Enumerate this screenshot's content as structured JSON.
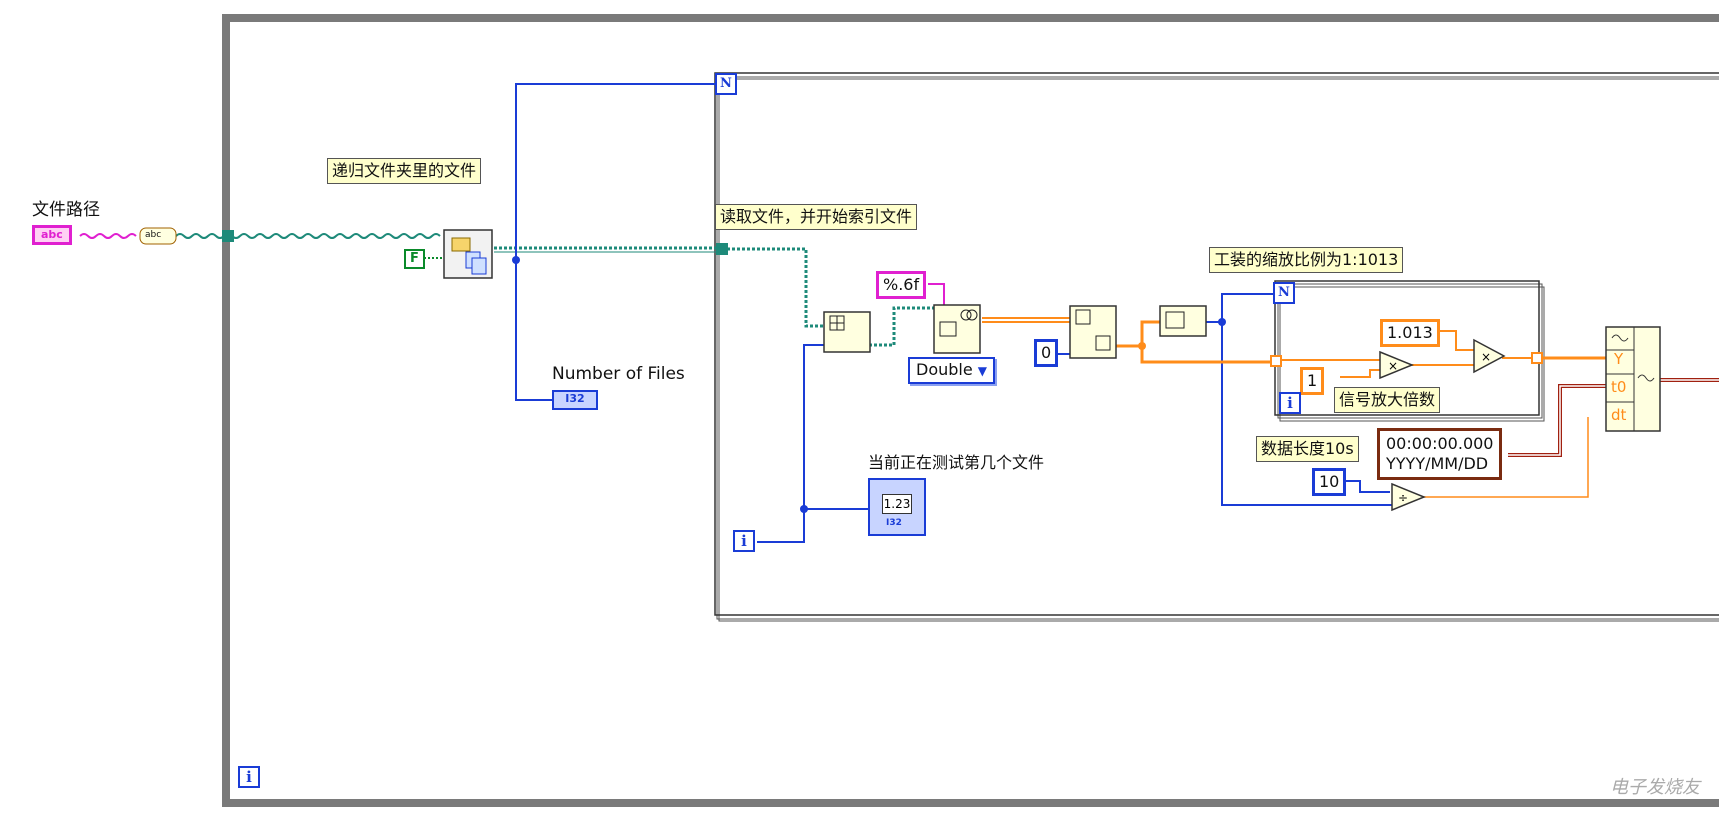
{
  "labels": {
    "file_path": "文件路径",
    "number_of_files": "Number of Files",
    "current_file": "当前正在测试第几个文件"
  },
  "comments": {
    "recursive": "递归文件夹里的文件",
    "read_file": "读取文件，并开始索引文件",
    "scale": "工装的缩放比例为1:1013",
    "gain": "信号放大倍数",
    "data_length": "数据长度10s"
  },
  "constants": {
    "false_const": "F",
    "format": "%.6f",
    "type": "Double",
    "zero": "0",
    "scale_factor": "1.013",
    "gain_value": "1",
    "ten": "10",
    "timestamp_time": "00:00:00.000",
    "timestamp_date": "YYYY/MM/DD",
    "i32": "I32",
    "indicator_value": "1.23",
    "string_const": "abc"
  },
  "terminals": {
    "N": "N",
    "i": "i",
    "Y": "Y",
    "t0": "t0",
    "dt": "dt"
  },
  "colors": {
    "frame": "#7a7a7a",
    "wire_int": "#1a3cd6",
    "wire_path": "#1e8a7a",
    "wire_string": "#e020d0",
    "wire_double": "#ff8c1a",
    "wire_timestamp": "#a02010",
    "comment_bg": "#ffffcc"
  },
  "watermark": "电子发烧友"
}
